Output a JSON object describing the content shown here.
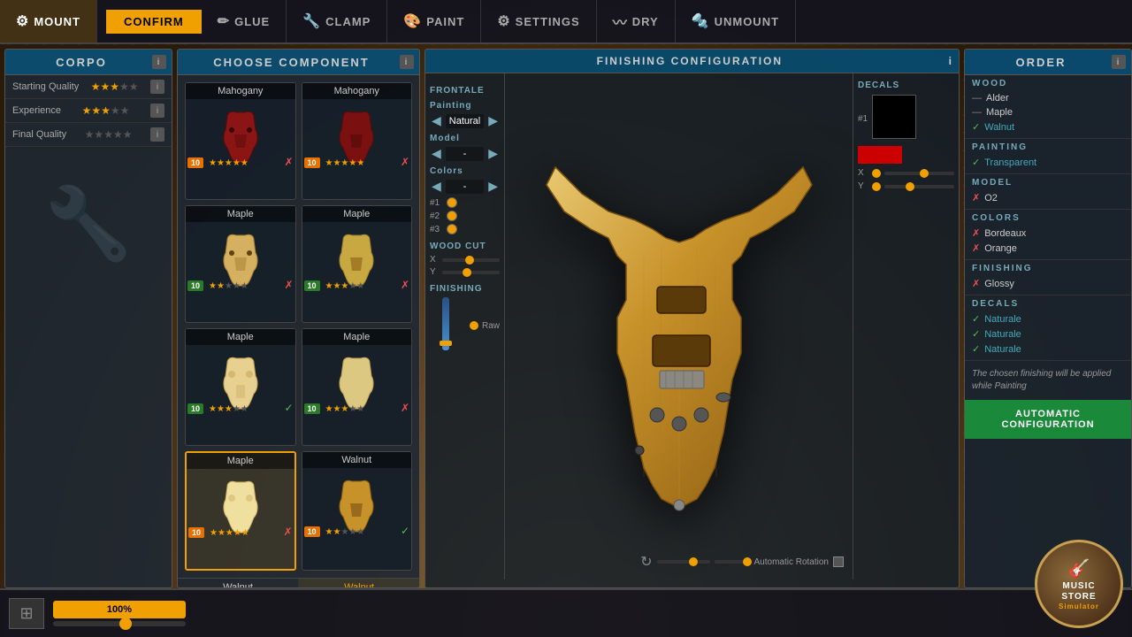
{
  "nav": {
    "items": [
      {
        "label": "MOUNT",
        "icon": "⚙",
        "active": true
      },
      {
        "label": "GLUE",
        "icon": "✏"
      },
      {
        "label": "CLAMP",
        "icon": "🔧"
      },
      {
        "label": "PAINT",
        "icon": "🎨"
      },
      {
        "label": "SETTINGS",
        "icon": "⚙"
      },
      {
        "label": "DRY",
        "icon": "〰"
      },
      {
        "label": "UNMOUNT",
        "icon": "🔩"
      }
    ],
    "confirm_label": "CONFIRM"
  },
  "left_panel": {
    "title": "CORPO",
    "rows": [
      {
        "label": "Starting Quality",
        "stars": 3,
        "max": 5
      },
      {
        "label": "Experience",
        "stars": 3,
        "max": 5
      },
      {
        "label": "Final Quality",
        "stars": 0,
        "max": 5
      }
    ]
  },
  "component_panel": {
    "title": "CHOOSE COMPONENT",
    "items": [
      {
        "name": "Mahogany",
        "color": "#8b2020",
        "badge": "10",
        "badge_type": "orange",
        "stars": 5,
        "has_x": true
      },
      {
        "name": "Mahogany",
        "color": "#8b2020",
        "badge": "10",
        "badge_type": "orange",
        "stars": 5,
        "has_x": true
      },
      {
        "name": "Maple",
        "color": "#d4b060",
        "badge": "10",
        "badge_type": "green",
        "stars": 2,
        "has_x": true
      },
      {
        "name": "Maple",
        "color": "#d4b060",
        "badge": "10",
        "badge_type": "green",
        "stars": 3,
        "has_x": true
      },
      {
        "name": "Maple",
        "color": "#e8d090",
        "badge": "10",
        "badge_type": "green",
        "stars": 3,
        "has_x": false
      },
      {
        "name": "Maple",
        "color": "#e8d090",
        "badge": "10",
        "badge_type": "green",
        "stars": 3,
        "has_x": true
      },
      {
        "name": "Maple",
        "color": "#e8d090",
        "badge": "10",
        "badge_type": "orange",
        "stars": 5,
        "has_x": true,
        "selected": true
      },
      {
        "name": "Walnut",
        "color": "#c8922a",
        "badge": "10",
        "badge_type": "orange",
        "stars": 2,
        "has_check": true,
        "selected": false
      }
    ],
    "bottom_items": [
      {
        "name": "Walnut"
      },
      {
        "name": "Walnut",
        "selected": true
      }
    ]
  },
  "finishing_config": {
    "title": "FINISHING CONFIGURATION",
    "frontale_label": "FRONTALE",
    "painting_label": "Painting",
    "painting_value": "Natural",
    "model_label": "Model",
    "model_value": "-",
    "colors_label": "Colors",
    "colors_value": "-",
    "color_dots": [
      {
        "id": "#1",
        "color": "#f0a000"
      },
      {
        "id": "#2",
        "color": "#f0a000"
      },
      {
        "id": "#3",
        "color": "#f0a000"
      }
    ],
    "wood_cut_label": "WOOD CUT",
    "wood_x_label": "X",
    "wood_y_label": "Y",
    "finishing_label": "FINISHING",
    "finishing_raw": "Raw",
    "decals_label": "DECALS",
    "decal_x_label": "X",
    "decal_y_label": "Y"
  },
  "order_panel": {
    "title": "ORDER",
    "wood_section": "WOOD",
    "wood_items": [
      {
        "name": "Alder",
        "status": "inactive"
      },
      {
        "name": "Maple",
        "status": "inactive"
      },
      {
        "name": "Walnut",
        "status": "active",
        "icon": "✓"
      }
    ],
    "painting_section": "PAINTING",
    "painting_items": [
      {
        "name": "Transparent",
        "status": "active",
        "icon": "✓"
      }
    ],
    "model_section": "MODEL",
    "model_items": [
      {
        "name": "O2",
        "status": "error",
        "icon": "✗"
      }
    ],
    "colors_section": "COLORS",
    "colors_items": [
      {
        "name": "Bordeaux",
        "status": "error",
        "icon": "✗"
      },
      {
        "name": "Orange",
        "status": "error",
        "icon": "✗"
      }
    ],
    "finishing_section": "FINISHING",
    "finishing_items": [
      {
        "name": "Glossy",
        "status": "error",
        "icon": "✗"
      }
    ],
    "decals_section": "DECALS",
    "decals_items": [
      {
        "name": "Naturale",
        "status": "active",
        "icon": "✓"
      },
      {
        "name": "Naturale",
        "status": "active",
        "icon": "✓"
      },
      {
        "name": "Naturale",
        "status": "active",
        "icon": "✓"
      }
    ],
    "note": "The chosen finishing will be applied while Painting",
    "auto_config_label": "AUTOMATIC\nCONFIGURATION"
  },
  "bottom_bar": {
    "zoom_value": "100%",
    "auto_rotation_label": "Automatic Rotation"
  },
  "music_store": {
    "line1": "MUSIC",
    "line2": "STORE",
    "line3": "Simulator"
  }
}
